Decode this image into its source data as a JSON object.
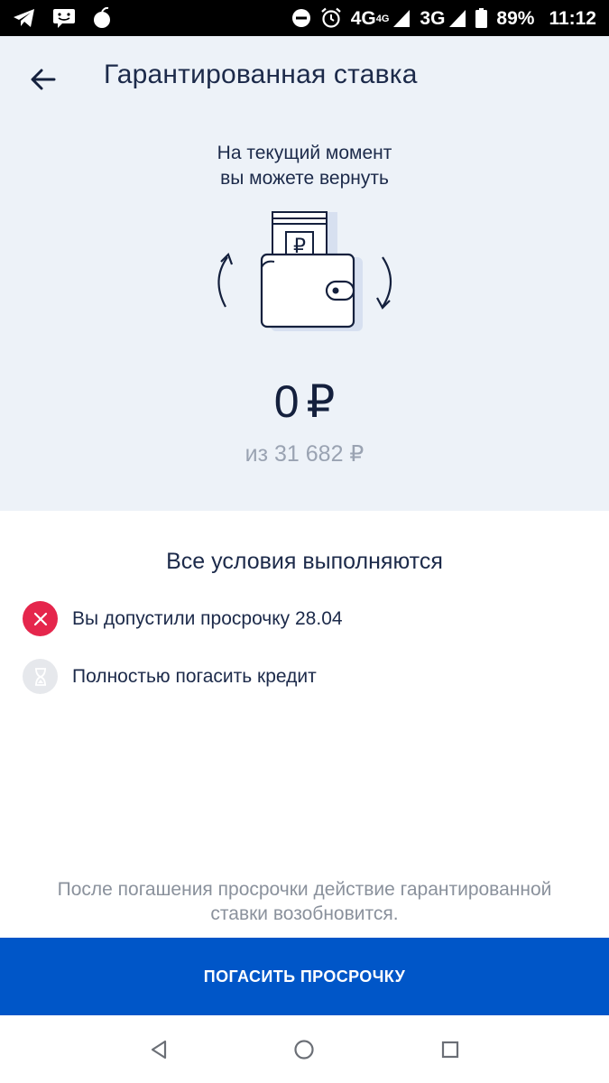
{
  "status_bar": {
    "network_1": "4G",
    "network_1_sup": "4G",
    "network_2": "3G",
    "battery": "89%",
    "time": "11:12",
    "icons": [
      "telegram-icon",
      "message-icon",
      "app-icon",
      "dnd-icon",
      "alarm-icon",
      "signal-icon",
      "battery-icon"
    ]
  },
  "header": {
    "title": "Гарантированная ставка"
  },
  "intro": {
    "line1": "На текущий момент",
    "line2": "вы можете вернуть"
  },
  "amount": {
    "value": "0",
    "currency": "₽",
    "of_text": "из 31 682 ₽"
  },
  "conditions": {
    "title": "Все условия выполняются",
    "items": [
      {
        "label": "Вы допустили просрочку 28.04",
        "status": "failed",
        "icon": "close-icon"
      },
      {
        "label": "Полностью погасить кредит",
        "status": "pending",
        "icon": "hourglass-icon"
      }
    ]
  },
  "note": {
    "line1": "После погашения просрочки действие гарантированной",
    "line2": "ставки возобновится."
  },
  "button": {
    "label": "ПОГАСИТЬ ПРОСРОЧКУ"
  },
  "colors": {
    "accent": "#0056c8",
    "error": "#e5264c",
    "header_bg": "#edf2f8",
    "text": "#1c2a4a",
    "muted": "#9aa3b2"
  }
}
